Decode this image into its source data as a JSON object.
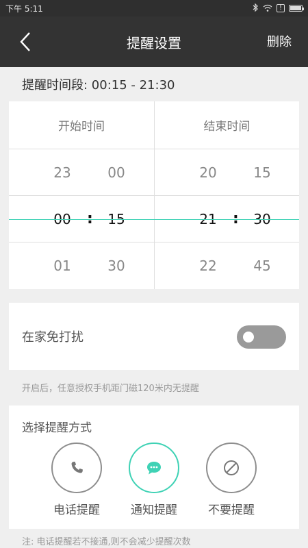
{
  "status_bar": {
    "time": "下午 5:11",
    "icons": [
      "bluetooth-icon",
      "wifi-icon",
      "alert-icon",
      "battery-icon"
    ],
    "alert_symbol": "!"
  },
  "header": {
    "back_icon": "chevron-left-icon",
    "title": "提醒设置",
    "delete_label": "删除"
  },
  "range": {
    "title": "提醒时间段: 00:15 - 21:30"
  },
  "picker": {
    "start": {
      "header": "开始时间",
      "rows": [
        {
          "h": "23",
          "m": "00"
        },
        {
          "h": "00",
          "m": "15"
        },
        {
          "h": "01",
          "m": "30"
        }
      ]
    },
    "end": {
      "header": "结束时间",
      "rows": [
        {
          "h": "20",
          "m": "15"
        },
        {
          "h": "21",
          "m": "30"
        },
        {
          "h": "22",
          "m": "45"
        }
      ]
    },
    "colon": ":"
  },
  "home_mode": {
    "label": "在家免打扰",
    "enabled": false
  },
  "hint": "开启后，任意授权手机距门磁120米内无提醒",
  "reminder_mode": {
    "title": "选择提醒方式",
    "options": [
      {
        "label": "电话提醒",
        "icon": "phone-icon",
        "selected": false
      },
      {
        "label": "通知提醒",
        "icon": "message-icon",
        "selected": true
      },
      {
        "label": "不要提醒",
        "icon": "block-icon",
        "selected": false
      }
    ]
  },
  "note": "注: 电话提醒若不接通,则不会减少提醒次数",
  "colors": {
    "accent": "#3fd2b5",
    "header_bg": "#333333",
    "page_bg": "#efefef"
  }
}
